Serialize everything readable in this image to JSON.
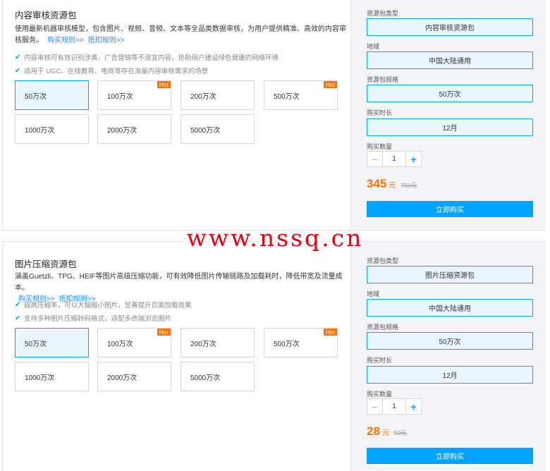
{
  "packages": [
    {
      "title": "内容审核资源包",
      "desc": "使用最新机器审核模型，包含图片、视频、音频、文本等全品类数据审核，为用户提供精准、高效的内容审核服务。",
      "link_rules": "购买规则>>",
      "link_deduct": "抵扣规则>>",
      "features": [
        "内容审核可有效识别涉黄、广告营销等不适宜内容，协助用户建设绿色健康的网络环境",
        "适用于 UGC、在线教育、电商等存在海量内容审核需求的场景"
      ],
      "options": [
        {
          "label": "50万次",
          "hot": ""
        },
        {
          "label": "100万次",
          "hot": "Hot"
        },
        {
          "label": "200万次",
          "hot": ""
        },
        {
          "label": "500万次",
          "hot": "Hot"
        },
        {
          "label": "1000万次",
          "hot": ""
        },
        {
          "label": "2000万次",
          "hot": ""
        },
        {
          "label": "5000万次",
          "hot": ""
        }
      ],
      "type_label": "资源包类型",
      "type_value": "内容审核资源包",
      "region_label": "地域",
      "region_value": "中国大陆通用",
      "spec_label": "资源包规格",
      "spec_value": "50万次",
      "duration_label": "购买时长",
      "duration_value": "12月",
      "qty_label": "购买数量",
      "qty_minus": "−",
      "qty_value": "1",
      "qty_plus": "+",
      "price": "345",
      "price_unit": "元",
      "price_original": "750元",
      "buy_label": "立即购买"
    },
    {
      "title": "图片压缩资源包",
      "desc": "涵盖Guetzli、TPG、HEIF等图片高级压缩功能，可有效降低图片传输链路及加载耗时，降低带宽及流量成本。",
      "link_rules": "购买规则>>",
      "link_deduct": "抵扣规则>>",
      "features": [
        "超高压缩率，可以大幅缩小图片，显著提升页面加载效果",
        "支持多种图片压缩转码格式，适配多终端浏览图片"
      ],
      "options": [
        {
          "label": "50万次",
          "hot": ""
        },
        {
          "label": "100万次",
          "hot": "Hot"
        },
        {
          "label": "200万次",
          "hot": ""
        },
        {
          "label": "500万次",
          "hot": "Hot"
        },
        {
          "label": "1000万次",
          "hot": ""
        },
        {
          "label": "2000万次",
          "hot": ""
        },
        {
          "label": "5000万次",
          "hot": ""
        }
      ],
      "type_label": "资源包类型",
      "type_value": "图片压缩资源包",
      "region_label": "地域",
      "region_value": "中国大陆通用",
      "spec_label": "资源包规格",
      "spec_value": "50万次",
      "duration_label": "购买时长",
      "duration_value": "12月",
      "qty_label": "购买数量",
      "qty_minus": "−",
      "qty_value": "1",
      "qty_plus": "+",
      "price": "28",
      "price_unit": "元",
      "price_original": "50元",
      "buy_label": "立即购买"
    }
  ],
  "watermark": "www.nssq.cn",
  "icons": {
    "check": "check-icon"
  },
  "colors": {
    "accent": "#00a4ff",
    "price": "#ff7200",
    "hot": "#ff7200",
    "watermark": "#e60012"
  }
}
